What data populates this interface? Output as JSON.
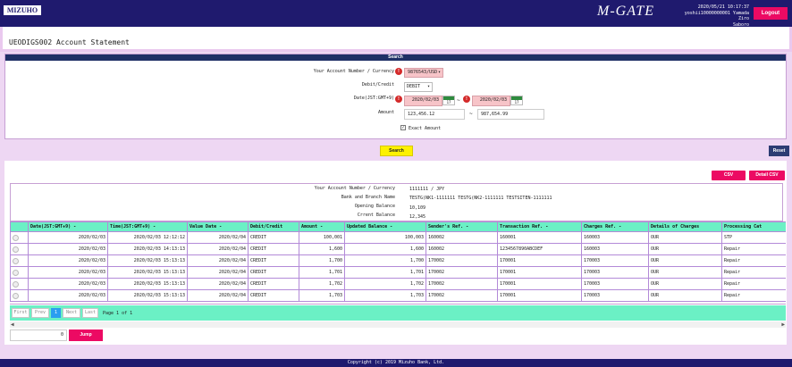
{
  "header": {
    "logo": "MIZUHO",
    "brand": "M-GATE",
    "datetime": "2020/05/21 10:17:37",
    "user_line": "yoshii10000000001 Yamada Ziro",
    "company": "Saboro",
    "logout_label": "Logout"
  },
  "page_title": "UEODIGS002 Account Statement",
  "search": {
    "heading": "Search",
    "account_label": "Your Account Number / Currency",
    "account_value": "9876543/USD",
    "debit_credit_label": "Debit/Credit",
    "debit_credit_value": "DEBIT",
    "date_label": "Date(JST:GMT+9)",
    "date_from": "2020/02/03",
    "date_to": "2020/02/03",
    "calendar_day": "17",
    "range_sep": "~",
    "amount_label": "Amount",
    "amount_from": "123,456.12",
    "amount_to": "987,654.99",
    "exact_amount_label": "Exact Amount",
    "search_button": "Search",
    "reset_button": "Reset",
    "required_mark": "!"
  },
  "results": {
    "csv_button": "CSV",
    "detail_csv_button": "Detail CSV",
    "summary": {
      "account_label": "Your Account Number / Currency",
      "account_value": "1111111 / JPY",
      "bank_label": "Bank and Branch Name",
      "bank_value": "TESTG(NK1-1111111 TESTG(NK2-1111111 TESTSITEN-1111111",
      "opening_label": "Opening Balance",
      "opening_value": "10,109",
      "current_label": "Crrent Balance",
      "current_value": "12,345"
    },
    "columns": [
      "",
      "Date(JST:GMT+9)",
      "Time(JST:GMT+9)",
      "Value Date",
      "Debit/Credit",
      "Amount",
      "Updated Balance",
      "Sender's Ref.",
      "Transaction Ref.",
      "Charges Ref.",
      "Details of Charges",
      "Processing Cat"
    ],
    "sort_icon": "-",
    "rows": [
      [
        "2020/02/03",
        "2020/02/03 12:12:12",
        "2020/02/04",
        "CREDIT",
        "100,001",
        "100,003",
        "160002",
        "160001",
        "160003",
        "OUR",
        "STP"
      ],
      [
        "2020/02/03",
        "2020/02/03 14:13:13",
        "2020/02/04",
        "CREDIT",
        "1,600",
        "1,600",
        "160002",
        "1234567890ABCDEF",
        "160003",
        "OUR",
        "Repair"
      ],
      [
        "2020/02/03",
        "2020/02/03 15:13:13",
        "2020/02/04",
        "CREDIT",
        "1,700",
        "1,700",
        "170002",
        "170001",
        "170003",
        "OUR",
        "Repair"
      ],
      [
        "2020/02/03",
        "2020/02/03 15:13:13",
        "2020/02/04",
        "CREDIT",
        "1,701",
        "1,701",
        "170002",
        "170001",
        "170003",
        "OUR",
        "Repair"
      ],
      [
        "2020/02/03",
        "2020/02/03 15:13:13",
        "2020/02/04",
        "CREDIT",
        "1,702",
        "1,702",
        "170002",
        "170001",
        "170003",
        "OUR",
        "Repair"
      ],
      [
        "2020/02/03",
        "2020/02/03 15:13:13",
        "2020/02/04",
        "CREDIT",
        "1,703",
        "1,703",
        "170002",
        "170001",
        "170003",
        "OUR",
        "Repair"
      ]
    ],
    "pager": {
      "first": "First",
      "prev": "Prev",
      "current": "1",
      "next": "Next",
      "last": "Last",
      "page_info": "Page 1 of 1"
    },
    "jump_value": "0",
    "jump_button": "Jump"
  },
  "footer": "Copyright (c) 2019 Mizuho Bank, Ltd.",
  "colors": {
    "navy": "#1f1a6e",
    "pink_button": "#ec0a63",
    "table_header": "#6bf0c5",
    "panel_bg": "#eed7f3",
    "search_yellow": "#fdf100"
  }
}
